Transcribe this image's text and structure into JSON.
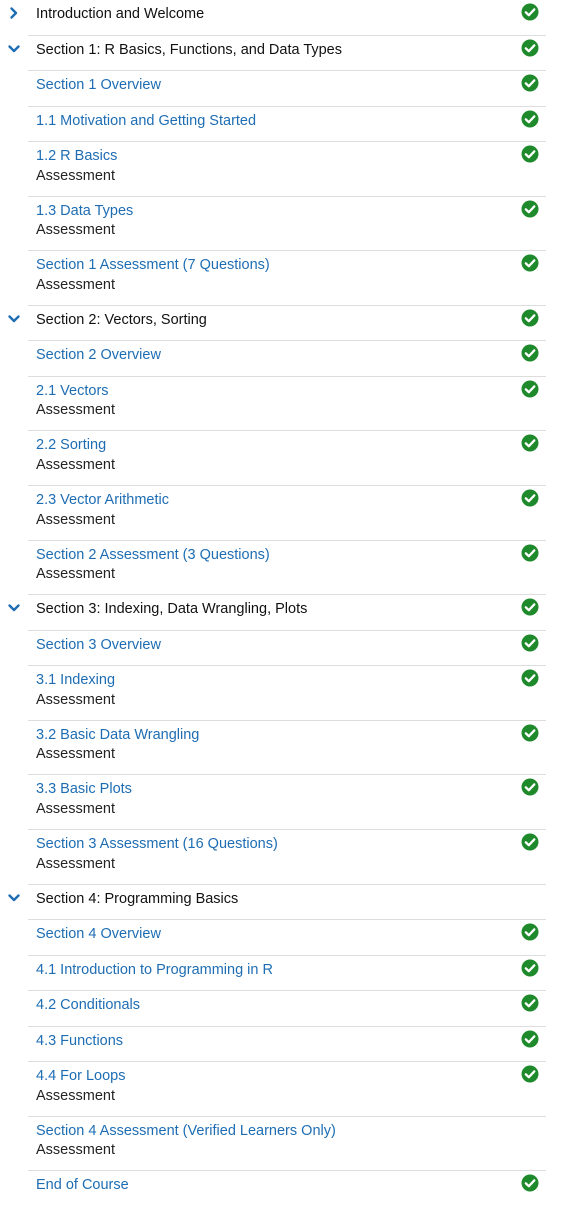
{
  "colors": {
    "link": "#1e6db3",
    "check": "#1f8a2b",
    "chevron": "#1e6db3"
  },
  "icons": {
    "collapsed": "chevron-right-icon",
    "expanded": "chevron-down-icon",
    "complete": "check-circle-icon"
  },
  "rows": [
    {
      "kind": "section",
      "title": "Introduction and Welcome",
      "expanded": false,
      "complete": true
    },
    {
      "kind": "section",
      "title": "Section 1: R Basics, Functions, and Data Types",
      "expanded": true,
      "complete": true
    },
    {
      "kind": "unit",
      "title": "Section 1 Overview",
      "complete": true
    },
    {
      "kind": "unit",
      "title": "1.1 Motivation and Getting Started",
      "complete": true
    },
    {
      "kind": "unit",
      "title": "1.2 R Basics",
      "subtitle": "Assessment",
      "complete": true
    },
    {
      "kind": "unit",
      "title": "1.3 Data Types",
      "subtitle": "Assessment",
      "complete": true
    },
    {
      "kind": "unit",
      "title": "Section 1 Assessment (7 Questions)",
      "subtitle": "Assessment",
      "complete": true
    },
    {
      "kind": "section",
      "title": "Section 2: Vectors, Sorting",
      "expanded": true,
      "complete": true
    },
    {
      "kind": "unit",
      "title": "Section 2 Overview",
      "complete": true
    },
    {
      "kind": "unit",
      "title": "2.1 Vectors",
      "subtitle": "Assessment",
      "complete": true
    },
    {
      "kind": "unit",
      "title": "2.2 Sorting",
      "subtitle": "Assessment",
      "complete": true
    },
    {
      "kind": "unit",
      "title": "2.3 Vector Arithmetic",
      "subtitle": "Assessment",
      "complete": true
    },
    {
      "kind": "unit",
      "title": "Section 2 Assessment (3 Questions)",
      "subtitle": "Assessment",
      "complete": true
    },
    {
      "kind": "section",
      "title": "Section 3: Indexing, Data Wrangling, Plots",
      "expanded": true,
      "complete": true
    },
    {
      "kind": "unit",
      "title": "Section 3 Overview",
      "complete": true
    },
    {
      "kind": "unit",
      "title": "3.1 Indexing",
      "subtitle": "Assessment",
      "complete": true
    },
    {
      "kind": "unit",
      "title": "3.2 Basic Data Wrangling",
      "subtitle": "Assessment",
      "complete": true
    },
    {
      "kind": "unit",
      "title": "3.3 Basic Plots",
      "subtitle": "Assessment",
      "complete": true
    },
    {
      "kind": "unit",
      "title": "Section 3 Assessment (16 Questions)",
      "subtitle": "Assessment",
      "complete": true
    },
    {
      "kind": "section",
      "title": "Section 4: Programming Basics",
      "expanded": true,
      "complete": false
    },
    {
      "kind": "unit",
      "title": "Section 4 Overview",
      "complete": true
    },
    {
      "kind": "unit",
      "title": "4.1 Introduction to Programming in R",
      "complete": true
    },
    {
      "kind": "unit",
      "title": "4.2 Conditionals",
      "complete": true
    },
    {
      "kind": "unit",
      "title": "4.3 Functions",
      "complete": true
    },
    {
      "kind": "unit",
      "title": "4.4 For Loops",
      "subtitle": "Assessment",
      "complete": true
    },
    {
      "kind": "unit",
      "title": "Section 4 Assessment (Verified Learners Only)",
      "subtitle": "Assessment",
      "complete": false
    },
    {
      "kind": "unit",
      "title": "End of Course",
      "complete": true
    }
  ]
}
